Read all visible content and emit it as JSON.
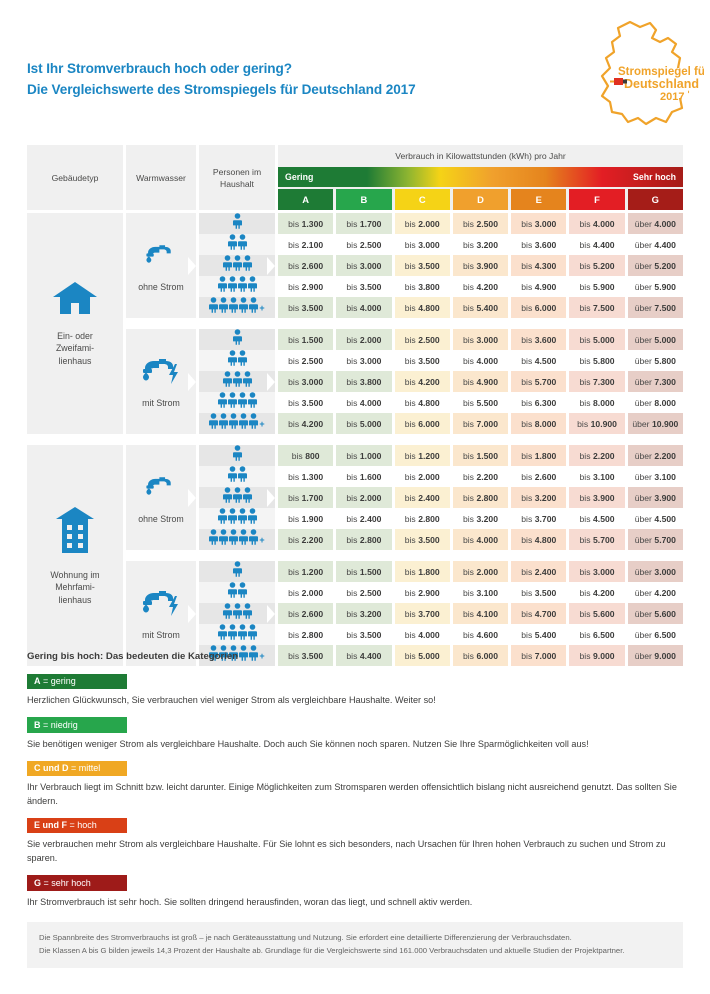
{
  "header": {
    "title_line1": "Ist Ihr Stromverbrauch hoch oder gering?",
    "title_line2": "Die Vergleichswerte des Stromspiegels für Deutschland 2017",
    "title_color": "#1b86c3",
    "logo": {
      "line1": "Stromspiegel für",
      "line2": "Deutschland",
      "line3": "2017",
      "color": "#f0a32a"
    }
  },
  "table": {
    "col_building": "Gebäudetyp",
    "col_water": "Warmwasser",
    "col_persons_l1": "Personen im",
    "col_persons_l2": "Haushalt",
    "consumption_header": "Verbrauch in Kilowattstunden (kWh) pro Jahr",
    "scale_low": "Gering",
    "scale_high": "Sehr hoch",
    "classes": [
      "A",
      "B",
      "C",
      "D",
      "E",
      "F",
      "G"
    ],
    "class_colors": [
      "#1e7b35",
      "#27a64c",
      "#f5d316",
      "#f0a02d",
      "#e5841d",
      "#e31e24",
      "#a51d18"
    ],
    "cell_tints": [
      "#dfe9d8",
      "#dfe9d8",
      "#fbf0d2",
      "#fbe7cd",
      "#fbe0cd",
      "#f7dbd2",
      "#e7cec7"
    ],
    "prefix_bis": "bis",
    "prefix_ueber": "über"
  },
  "chart_data": {
    "type": "table",
    "title": "Die Vergleichswerte des Stromspiegels für Deutschland 2017",
    "unit": "kWh pro Jahr",
    "columns": [
      "A",
      "B",
      "C",
      "D",
      "E",
      "F",
      "G"
    ],
    "blocks": [
      {
        "building": "Ein- oder Zweifami-lienhaus",
        "building_lines": [
          "Ein- oder",
          "Zweifami-",
          "lienhaus"
        ],
        "building_icon": "house-icon",
        "subblocks": [
          {
            "water": "ohne Strom",
            "water_icon": "faucet-icon",
            "rows": [
              {
                "persons": 1,
                "plus": false,
                "values": [
                  "bis 1.300",
                  "bis 1.700",
                  "bis 2.000",
                  "bis 2.500",
                  "bis 3.000",
                  "bis 4.000",
                  "über 4.000"
                ]
              },
              {
                "persons": 2,
                "plus": false,
                "values": [
                  "bis 2.100",
                  "bis 2.500",
                  "bis 3.000",
                  "bis 3.200",
                  "bis 3.600",
                  "bis 4.400",
                  "über 4.400"
                ]
              },
              {
                "persons": 3,
                "plus": false,
                "values": [
                  "bis 2.600",
                  "bis 3.000",
                  "bis 3.500",
                  "bis 3.900",
                  "bis 4.300",
                  "bis 5.200",
                  "über 5.200"
                ]
              },
              {
                "persons": 4,
                "plus": false,
                "values": [
                  "bis 2.900",
                  "bis 3.500",
                  "bis 3.800",
                  "bis 4.200",
                  "bis 4.900",
                  "bis 5.900",
                  "über 5.900"
                ]
              },
              {
                "persons": 5,
                "plus": true,
                "values": [
                  "bis 3.500",
                  "bis 4.000",
                  "bis 4.800",
                  "bis 5.400",
                  "bis 6.000",
                  "bis 7.500",
                  "über 7.500"
                ]
              }
            ]
          },
          {
            "water": "mit Strom",
            "water_icon": "faucet-bolt-icon",
            "rows": [
              {
                "persons": 1,
                "plus": false,
                "values": [
                  "bis 1.500",
                  "bis 2.000",
                  "bis 2.500",
                  "bis 3.000",
                  "bis 3.600",
                  "bis 5.000",
                  "über 5.000"
                ]
              },
              {
                "persons": 2,
                "plus": false,
                "values": [
                  "bis 2.500",
                  "bis 3.000",
                  "bis 3.500",
                  "bis 4.000",
                  "bis 4.500",
                  "bis 5.800",
                  "über 5.800"
                ]
              },
              {
                "persons": 3,
                "plus": false,
                "values": [
                  "bis 3.000",
                  "bis 3.800",
                  "bis 4.200",
                  "bis 4.900",
                  "bis 5.700",
                  "bis 7.300",
                  "über 7.300"
                ]
              },
              {
                "persons": 4,
                "plus": false,
                "values": [
                  "bis 3.500",
                  "bis 4.000",
                  "bis 4.800",
                  "bis 5.500",
                  "bis 6.300",
                  "bis 8.000",
                  "über 8.000"
                ]
              },
              {
                "persons": 5,
                "plus": true,
                "values": [
                  "bis 4.200",
                  "bis 5.000",
                  "bis 6.000",
                  "bis 7.000",
                  "bis 8.000",
                  "bis 10.900",
                  "über 10.900"
                ]
              }
            ]
          }
        ]
      },
      {
        "building": "Wohnung im Mehrfami-lienhaus",
        "building_lines": [
          "Wohnung im",
          "Mehrfami-",
          "lienhaus"
        ],
        "building_icon": "apartment-icon",
        "subblocks": [
          {
            "water": "ohne Strom",
            "water_icon": "faucet-icon",
            "rows": [
              {
                "persons": 1,
                "plus": false,
                "values": [
                  "bis 800",
                  "bis 1.000",
                  "bis 1.200",
                  "bis 1.500",
                  "bis 1.800",
                  "bis 2.200",
                  "über 2.200"
                ]
              },
              {
                "persons": 2,
                "plus": false,
                "values": [
                  "bis 1.300",
                  "bis 1.600",
                  "bis 2.000",
                  "bis 2.200",
                  "bis 2.600",
                  "bis 3.100",
                  "über 3.100"
                ]
              },
              {
                "persons": 3,
                "plus": false,
                "values": [
                  "bis 1.700",
                  "bis 2.000",
                  "bis 2.400",
                  "bis 2.800",
                  "bis 3.200",
                  "bis 3.900",
                  "über 3.900"
                ]
              },
              {
                "persons": 4,
                "plus": false,
                "values": [
                  "bis 1.900",
                  "bis 2.400",
                  "bis 2.800",
                  "bis 3.200",
                  "bis 3.700",
                  "bis 4.500",
                  "über 4.500"
                ]
              },
              {
                "persons": 5,
                "plus": true,
                "values": [
                  "bis 2.200",
                  "bis 2.800",
                  "bis 3.500",
                  "bis 4.000",
                  "bis 4.800",
                  "bis 5.700",
                  "über 5.700"
                ]
              }
            ]
          },
          {
            "water": "mit Strom",
            "water_icon": "faucet-bolt-icon",
            "rows": [
              {
                "persons": 1,
                "plus": false,
                "values": [
                  "bis 1.200",
                  "bis 1.500",
                  "bis 1.800",
                  "bis 2.000",
                  "bis 2.400",
                  "bis 3.000",
                  "über 3.000"
                ]
              },
              {
                "persons": 2,
                "plus": false,
                "values": [
                  "bis 2.000",
                  "bis 2.500",
                  "bis 2.900",
                  "bis 3.100",
                  "bis 3.500",
                  "bis 4.200",
                  "über 4.200"
                ]
              },
              {
                "persons": 3,
                "plus": false,
                "values": [
                  "bis 2.600",
                  "bis 3.200",
                  "bis 3.700",
                  "bis 4.100",
                  "bis 4.700",
                  "bis 5.600",
                  "über 5.600"
                ]
              },
              {
                "persons": 4,
                "plus": false,
                "values": [
                  "bis 2.800",
                  "bis 3.500",
                  "bis 4.000",
                  "bis 4.600",
                  "bis 5.400",
                  "bis 6.500",
                  "über 6.500"
                ]
              },
              {
                "persons": 5,
                "plus": true,
                "values": [
                  "bis 3.500",
                  "bis 4.400",
                  "bis 5.000",
                  "bis 6.000",
                  "bis 7.000",
                  "bis 9.000",
                  "über 9.000"
                ]
              }
            ]
          }
        ]
      }
    ]
  },
  "legend": {
    "title": "Gering bis hoch: Das bedeuten die Kategorien",
    "items": [
      {
        "key": "A",
        "value": "= gering",
        "color": "#1e7b35",
        "text": "Herzlichen Glückwunsch, Sie verbrauchen viel weniger Strom als vergleichbare Haushalte. Weiter so!"
      },
      {
        "key": "B",
        "value": "= niedrig",
        "color": "#27a64c",
        "text": "Sie benötigen weniger Strom als vergleichbare Haushalte. Doch auch Sie können noch sparen. Nutzen Sie Ihre Sparmöglichkeiten voll aus!"
      },
      {
        "key": "C und D",
        "value": "= mittel",
        "color": "#f0a824",
        "text": "Ihr Verbrauch liegt im Schnitt bzw. leicht darunter. Einige Möglichkeiten zum Stromsparen werden offensichtlich bislang nicht ausreichend genutzt. Das sollten Sie ändern."
      },
      {
        "key": "E und F",
        "value": "= hoch",
        "color": "#d94016",
        "text": "Sie verbrauchen mehr Strom als vergleichbare Haushalte. Für Sie lohnt es sich besonders, nach Ursachen für Ihren hohen Verbrauch zu suchen und Strom zu sparen."
      },
      {
        "key": "G",
        "value": "= sehr hoch",
        "color": "#9e1b19",
        "text": "Ihr Stromverbrauch ist sehr hoch. Sie sollten dringend herausfinden, woran das liegt, und schnell aktiv werden."
      }
    ]
  },
  "footer": {
    "line1": "Die Spannbreite des Stromverbrauchs ist groß – je nach Geräteausstattung und Nutzung. Sie erfordert eine detaillierte Differenzierung der Verbrauchsdaten.",
    "line2": "Die Klassen A bis G bilden jeweils 14,3 Prozent der Haushalte ab. Grundlage für die Vergleichswerte sind 161.000 Verbrauchsdaten und aktuelle Studien der Projektpartner."
  }
}
